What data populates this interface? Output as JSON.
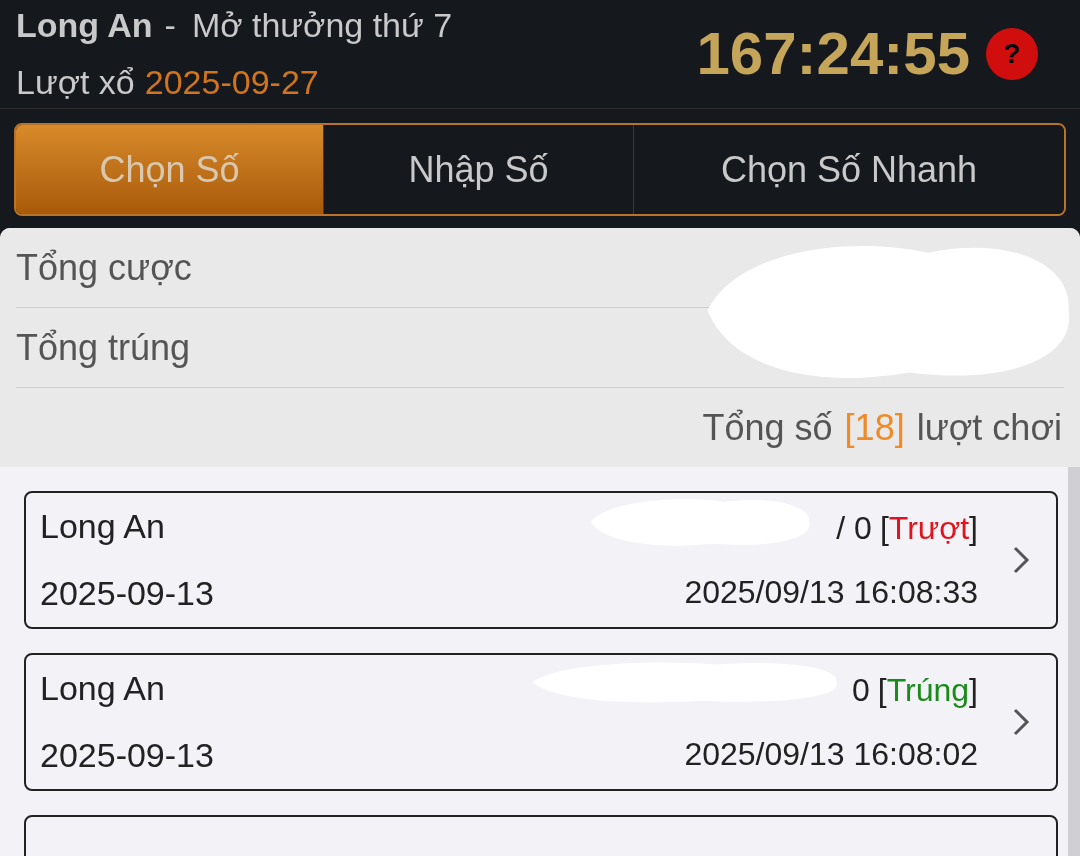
{
  "header": {
    "province": "Long An",
    "separator": "-",
    "draw_label": "Mở thưởng thứ 7",
    "round_label": "Lượt xổ",
    "round_date": "2025-09-27",
    "countdown": "167:24:55",
    "help": "?"
  },
  "tabs": [
    {
      "label": "Chọn Số",
      "selected": true
    },
    {
      "label": "Nhập Số",
      "selected": false
    },
    {
      "label": "Chọn Số Nhanh",
      "selected": false
    }
  ],
  "summary": {
    "rows": [
      {
        "label": "Tổng cược"
      },
      {
        "label": "Tổng trúng"
      }
    ],
    "total_prefix": "Tổng số",
    "total_count": "[18]",
    "total_suffix": "lượt chơi"
  },
  "tickets": [
    {
      "province": "Long An",
      "date": "2025-09-13",
      "amount": "/ 0",
      "bracket_open": "[",
      "status": "Trượt",
      "bracket_close": "]",
      "kind": "lose",
      "time": "2025/09/13 16:08:33"
    },
    {
      "province": "Long An",
      "date": "2025-09-13",
      "amount": "0",
      "bracket_open": "[",
      "status": "Trúng",
      "bracket_close": "]",
      "kind": "win",
      "time": "2025/09/13 16:08:02"
    }
  ]
}
